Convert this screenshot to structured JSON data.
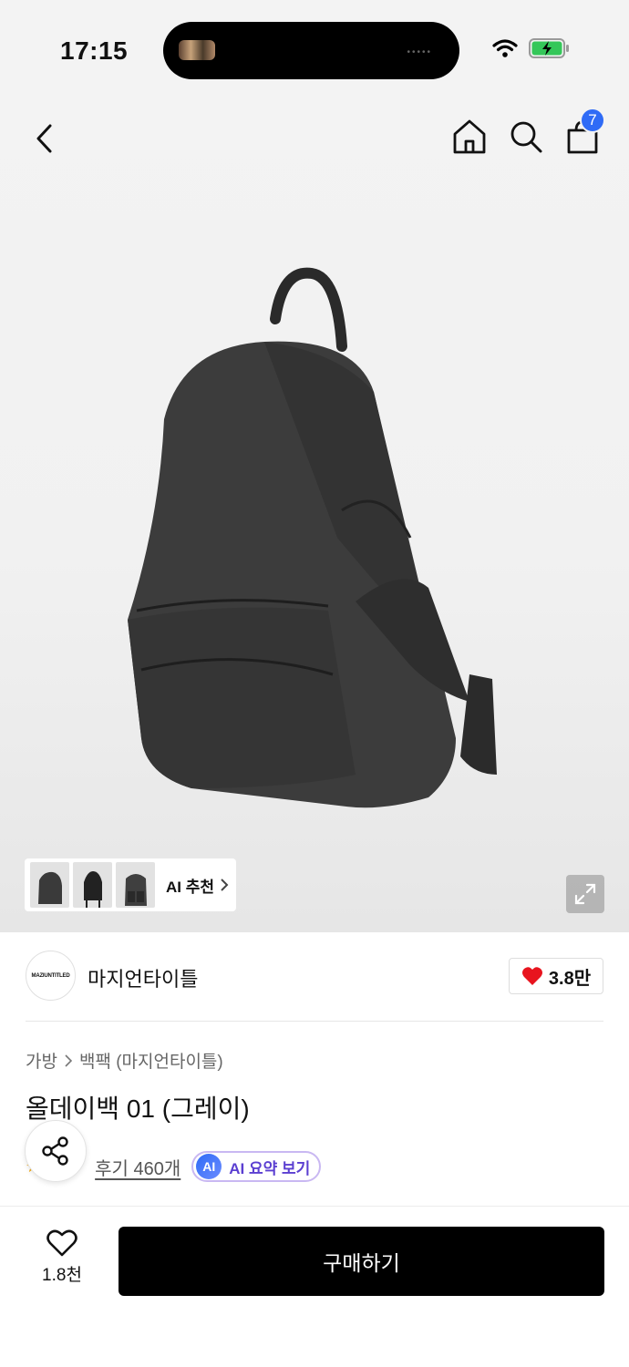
{
  "status_bar": {
    "time": "17:15"
  },
  "nav": {
    "back_icon": "chevron-left-icon",
    "home_icon": "home-icon",
    "search_icon": "search-icon",
    "cart_icon": "shopping-bag-icon",
    "cart_count": "7"
  },
  "gallery": {
    "ai_reco_label": "AI 추천",
    "expand_icon": "expand-icon"
  },
  "brand": {
    "logo_text": "MAZIUNTITLED",
    "name": "마지언타이틀",
    "like_count": "3.8만"
  },
  "breadcrumb": {
    "category": "가방",
    "subcategory": "백팩 (마지언타이틀)"
  },
  "product": {
    "title": "올데이백 01 (그레이)"
  },
  "reviews": {
    "review_link": "후기 460개",
    "ai_badge": "AI",
    "ai_summary_label": "AI 요약 보기"
  },
  "bottom_bar": {
    "wish_count": "1.8천",
    "buy_label": "구매하기"
  },
  "colors": {
    "badge_blue": "#2f6bf6",
    "heart_red": "#e8141e",
    "ai_purple": "#5b3fd1",
    "buy_black": "#000000"
  }
}
